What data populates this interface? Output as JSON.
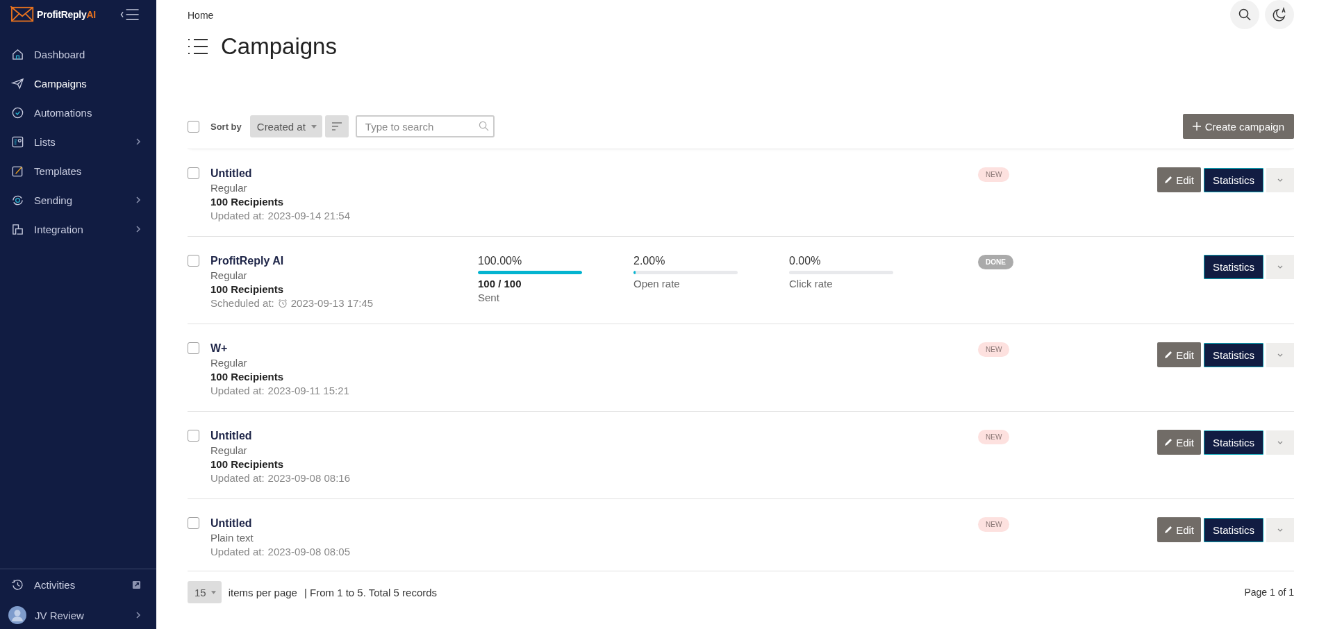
{
  "sidebar": {
    "logo": {
      "text": "ProfitReply",
      "accent": "AI"
    },
    "items": [
      {
        "label": "Dashboard",
        "has_submenu": false,
        "selected": false
      },
      {
        "label": "Campaigns",
        "has_submenu": false,
        "selected": true
      },
      {
        "label": "Automations",
        "has_submenu": false,
        "selected": false
      },
      {
        "label": "Lists",
        "has_submenu": true,
        "selected": false
      },
      {
        "label": "Templates",
        "has_submenu": false,
        "selected": false
      },
      {
        "label": "Sending",
        "has_submenu": true,
        "selected": false
      },
      {
        "label": "Integration",
        "has_submenu": true,
        "selected": false
      }
    ],
    "activities": {
      "label": "Activities"
    },
    "user": {
      "name": "JV Review"
    }
  },
  "breadcrumb": "Home",
  "page_title": "Campaigns",
  "toolbar": {
    "select_all": false,
    "sort_label": "Sort by",
    "sort_value": "Created at",
    "search": {
      "placeholder": "Type to search"
    },
    "create_button": "Create campaign"
  },
  "campaigns": [
    {
      "name": "Untitled",
      "type": "Regular",
      "recipients": "100 Recipients",
      "date_label": "Updated at:",
      "date": "2023-09-14 21:54",
      "scheduled": false,
      "status": "NEW",
      "color": "#fde1df",
      "edit_button": "Edit",
      "statistics_button": "Statistics",
      "checked": false
    },
    {
      "name": "ProfitReply AI",
      "type": "Regular",
      "recipients": "100 Recipients",
      "date_label": "Scheduled at:",
      "date": "2023-09-13 17:45",
      "scheduled": true,
      "status": "DONE",
      "color": "#aaaaaa",
      "statistics_button": "Statistics",
      "checked": false,
      "stats": [
        {
          "value": "100.00%",
          "level": 1,
          "count": "100 / 100",
          "label": "Sent"
        },
        {
          "value": "2.00%",
          "level": 0.02,
          "label": "Open rate"
        },
        {
          "value": "0.00%",
          "level": 0,
          "label": "Click rate"
        }
      ]
    },
    {
      "name": "W+",
      "type": "Regular",
      "recipients": "100 Recipients",
      "date_label": "Updated at:",
      "date": "2023-09-11 15:21",
      "scheduled": false,
      "status": "NEW",
      "color": "#fde1df",
      "edit_button": "Edit",
      "statistics_button": "Statistics",
      "checked": false
    },
    {
      "name": "Untitled",
      "type": "Regular",
      "recipients": "100 Recipients",
      "date_label": "Updated at:",
      "date": "2023-09-08 08:16",
      "scheduled": false,
      "status": "NEW",
      "color": "#fde1df",
      "edit_button": "Edit",
      "statistics_button": "Statistics",
      "checked": false
    },
    {
      "name": "Untitled",
      "type": "Plain text",
      "date_label": "Updated at:",
      "date": "2023-09-08 08:05",
      "scheduled": false,
      "status": "NEW",
      "color": "#fde1df",
      "edit_button": "Edit",
      "statistics_button": "Statistics",
      "checked": false
    }
  ],
  "footer": {
    "per_page": "15",
    "per_page_label": "items per page",
    "summary": "| From 1 to 5. Total 5 records",
    "page": "Page 1 of 1"
  }
}
